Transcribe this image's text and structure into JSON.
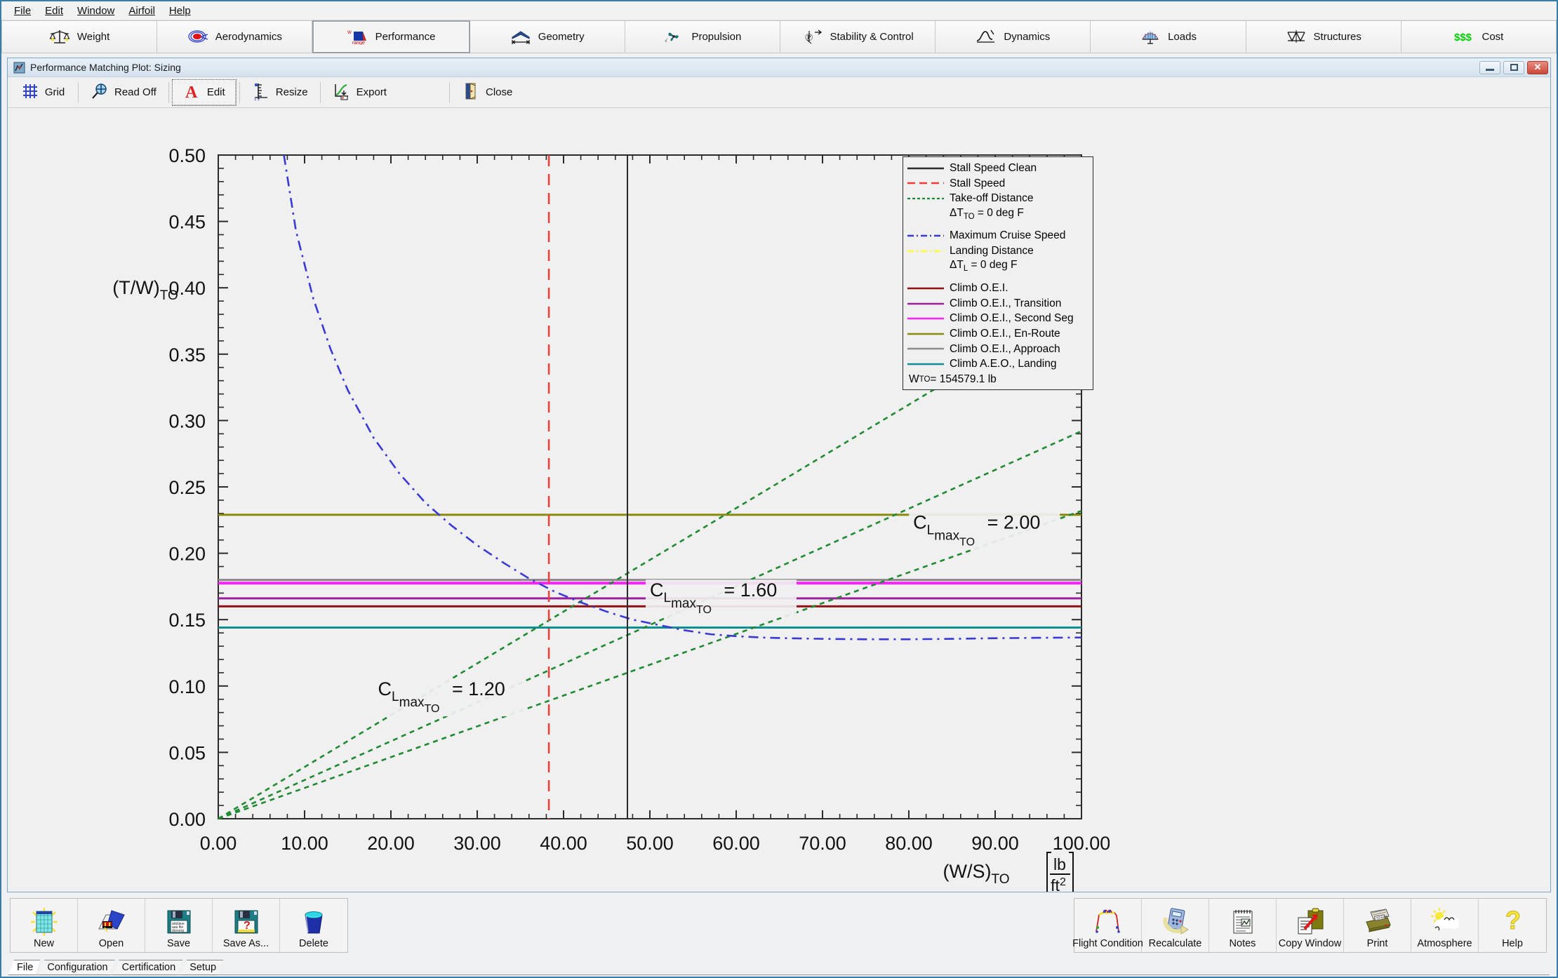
{
  "menu": {
    "items": [
      "File",
      "Edit",
      "Window",
      "Airfoil",
      "Help"
    ]
  },
  "modules": [
    {
      "label": "Weight",
      "icon": "balance-scale-icon",
      "active": false
    },
    {
      "label": "Aerodynamics",
      "icon": "airfoil-flow-icon",
      "active": false
    },
    {
      "label": "Performance",
      "icon": "range-chart-icon",
      "active": true
    },
    {
      "label": "Geometry",
      "icon": "wing-span-icon",
      "active": false
    },
    {
      "label": "Propulsion",
      "icon": "propeller-icon",
      "active": false
    },
    {
      "label": "Stability & Control",
      "icon": "axes-arrows-icon",
      "active": false
    },
    {
      "label": "Dynamics",
      "icon": "response-curve-icon",
      "active": false
    },
    {
      "label": "Loads",
      "icon": "load-distribution-icon",
      "active": false
    },
    {
      "label": "Structures",
      "icon": "truss-icon",
      "active": false
    },
    {
      "label": "Cost",
      "icon": "dollar-icon",
      "active": false
    }
  ],
  "window": {
    "title": "Performance Matching Plot: Sizing",
    "icon": "app-window-icon",
    "minimize_label": "",
    "maximize_label": "",
    "close_label": "✕"
  },
  "plot_toolbar": [
    {
      "label": "Grid",
      "icon": "grid-icon",
      "pressed": false
    },
    {
      "label": "Read Off",
      "icon": "crosshair-magnifier-icon",
      "pressed": false
    },
    {
      "label": "Edit",
      "icon": "letter-a-icon",
      "pressed": true
    },
    {
      "label": "Resize",
      "icon": "ruler-icon",
      "pressed": false
    },
    {
      "label": "Export",
      "icon": "export-curve-icon",
      "pressed": false
    },
    {
      "label": "Close",
      "icon": "exit-door-icon",
      "pressed": false
    }
  ],
  "legend": {
    "rows": [
      {
        "label": "Stall Speed Clean",
        "color": "#2b2b2b",
        "style": "solid"
      },
      {
        "label": "Stall Speed",
        "color": "#f43b35",
        "style": "dashed"
      },
      {
        "label": "Take-off Distance",
        "color": "#1f8a32",
        "style": "dotted"
      },
      {
        "label": "ΔT<TO> = 0 deg F",
        "color": "",
        "style": "continuation"
      },
      {
        "label": "",
        "color": "",
        "style": "spacer"
      },
      {
        "label": "Maximum Cruise Speed",
        "color": "#3b39d4",
        "style": "dashdot"
      },
      {
        "label": "Landing Distance",
        "color": "#ffff33",
        "style": "dashdot"
      },
      {
        "label": "ΔT<L> = 0 deg F",
        "color": "",
        "style": "continuation"
      },
      {
        "label": "",
        "color": "",
        "style": "spacer"
      },
      {
        "label": "Climb O.E.I.",
        "color": "#8e1010",
        "style": "solid"
      },
      {
        "label": "Climb O.E.I., Transition",
        "color": "#9c1f9c",
        "style": "solid"
      },
      {
        "label": "Climb O.E.I., Second Seg",
        "color": "#ff1fff",
        "style": "solid"
      },
      {
        "label": "Climb O.E.I., En-Route",
        "color": "#8a8a10",
        "style": "solid"
      },
      {
        "label": "Climb O.E.I., Approach",
        "color": "#8c8c8c",
        "style": "solid"
      },
      {
        "label": "Climb A.E.O., Landing",
        "color": "#0e8f91",
        "style": "solid"
      }
    ],
    "footer_prefix": "W",
    "footer_sub": "TO",
    "footer_value": " = 154579.1 lb"
  },
  "chart_data": {
    "type": "line",
    "title": "Performance Matching Plot: Sizing",
    "xlabel": "(W/S)TO",
    "xlabel_main": "(W/S)",
    "xlabel_sub": "TO",
    "xunits_num": "lb",
    "xunits_den": "ft",
    "xunits_den_exp": "2",
    "ylabel_main": "(T/W)",
    "ylabel_sub": "TO",
    "xlim": [
      0,
      100
    ],
    "ylim": [
      0,
      0.5
    ],
    "xticks": [
      "0.00",
      "10.00",
      "20.00",
      "30.00",
      "40.00",
      "50.00",
      "60.00",
      "70.00",
      "80.00",
      "90.00",
      "100.00"
    ],
    "xtick_values": [
      0,
      10,
      20,
      30,
      40,
      50,
      60,
      70,
      80,
      90,
      100
    ],
    "yticks": [
      "0.00",
      "0.05",
      "0.10",
      "0.15",
      "0.20",
      "0.25",
      "0.30",
      "0.35",
      "0.40",
      "0.45",
      "0.50"
    ],
    "ytick_values": [
      0,
      0.05,
      0.1,
      0.15,
      0.2,
      0.25,
      0.3,
      0.35,
      0.4,
      0.45,
      0.5
    ],
    "x_minor_per_major": 5,
    "y_minor_per_major": 5,
    "grid": false,
    "legend_position": "right-outside",
    "vertical_lines": [
      {
        "name": "Stall Speed Clean",
        "x": 47.4,
        "color": "#2b2b2b",
        "style": "solid",
        "width": 2
      },
      {
        "name": "Stall Speed",
        "x": 38.3,
        "color": "#f43b35",
        "style": "dashed",
        "width": 2.5
      }
    ],
    "horizontal_lines": [
      {
        "name": "Climb O.E.I., En-Route",
        "y": 0.229,
        "color": "#8a8a10",
        "width": 3
      },
      {
        "name": "Climb O.E.I., Approach",
        "y": 0.18,
        "color": "#8c8c8c",
        "width": 3
      },
      {
        "name": "Climb O.E.I., Second Seg",
        "y": 0.1775,
        "color": "#ff1fff",
        "width": 4
      },
      {
        "name": "Climb O.E.I., Transition",
        "y": 0.166,
        "color": "#9c1f9c",
        "width": 3
      },
      {
        "name": "Climb O.E.I.",
        "y": 0.16,
        "color": "#8e1010",
        "width": 3
      },
      {
        "name": "Climb A.E.O., Landing",
        "y": 0.144,
        "color": "#0e8f91",
        "width": 3
      }
    ],
    "series": [
      {
        "name": "Take-off Distance CLmaxTO = 2.00",
        "color": "#1f8a32",
        "style": "dotted",
        "points": [
          [
            0,
            0
          ],
          [
            10,
            0.039
          ],
          [
            20,
            0.078
          ],
          [
            30,
            0.117
          ],
          [
            40,
            0.156
          ],
          [
            50,
            0.195
          ],
          [
            60,
            0.234
          ],
          [
            70,
            0.273
          ],
          [
            80,
            0.312
          ],
          [
            90,
            0.351
          ],
          [
            100,
            0.39
          ]
        ]
      },
      {
        "name": "Take-off Distance CLmaxTO = 1.60",
        "color": "#1f8a32",
        "style": "dotted",
        "points": [
          [
            0,
            0
          ],
          [
            10,
            0.0292
          ],
          [
            20,
            0.0584
          ],
          [
            30,
            0.0876
          ],
          [
            40,
            0.1168
          ],
          [
            50,
            0.146
          ],
          [
            60,
            0.1752
          ],
          [
            70,
            0.2044
          ],
          [
            80,
            0.2336
          ],
          [
            90,
            0.2628
          ],
          [
            100,
            0.292
          ]
        ]
      },
      {
        "name": "Take-off Distance CLmaxTO = 1.20",
        "color": "#1f8a32",
        "style": "dotted",
        "points": [
          [
            0,
            0
          ],
          [
            10,
            0.0232
          ],
          [
            20,
            0.0464
          ],
          [
            30,
            0.0696
          ],
          [
            40,
            0.0928
          ],
          [
            50,
            0.116
          ],
          [
            60,
            0.1392
          ],
          [
            70,
            0.1624
          ],
          [
            80,
            0.1856
          ],
          [
            90,
            0.2088
          ],
          [
            100,
            0.232
          ]
        ]
      },
      {
        "name": "Maximum Cruise Speed",
        "color": "#3b39d4",
        "style": "dashdot",
        "points": [
          [
            7.6,
            0.5
          ],
          [
            9,
            0.443
          ],
          [
            11,
            0.392
          ],
          [
            13,
            0.354
          ],
          [
            15,
            0.323
          ],
          [
            18,
            0.287
          ],
          [
            21,
            0.26
          ],
          [
            24,
            0.238
          ],
          [
            27,
            0.221
          ],
          [
            30,
            0.206
          ],
          [
            33,
            0.193
          ],
          [
            36,
            0.181
          ],
          [
            39,
            0.171
          ],
          [
            42,
            0.163
          ],
          [
            45,
            0.156
          ],
          [
            48,
            0.15
          ],
          [
            51,
            0.146
          ],
          [
            54,
            0.142
          ],
          [
            57,
            0.139
          ],
          [
            60,
            0.1375
          ],
          [
            63,
            0.1365
          ],
          [
            66,
            0.136
          ],
          [
            70,
            0.1355
          ],
          [
            75,
            0.1352
          ],
          [
            80,
            0.1352
          ],
          [
            85,
            0.1355
          ],
          [
            90,
            0.136
          ],
          [
            95,
            0.1363
          ],
          [
            100,
            0.1365
          ]
        ]
      }
    ],
    "annotations": [
      {
        "text_prefix": "C",
        "sub1": "L",
        "sub2": "max",
        "sub3": "TO",
        "value": " = 2.00",
        "x": 80.5,
        "y": 0.2185
      },
      {
        "text_prefix": "C",
        "sub1": "L",
        "sub2": "max",
        "sub3": "TO",
        "value": " = 1.60",
        "x": 50.0,
        "y": 0.1675
      },
      {
        "text_prefix": "C",
        "sub1": "L",
        "sub2": "max",
        "sub3": "TO",
        "value": " = 1.20",
        "x": 18.5,
        "y": 0.093
      }
    ]
  },
  "bottom_left_buttons": [
    {
      "label": "New",
      "icon": "new-spreadsheet-icon"
    },
    {
      "label": "Open",
      "icon": "open-folder-icon"
    },
    {
      "label": "Save",
      "icon": "floppy-disk-icon"
    },
    {
      "label": "Save As...",
      "icon": "floppy-disk-question-icon"
    },
    {
      "label": "Delete",
      "icon": "trash-bin-icon"
    }
  ],
  "bottom_right_buttons": [
    {
      "label": "Flight Condition",
      "icon": "flight-profile-icon"
    },
    {
      "label": "Recalculate",
      "icon": "calculator-refresh-icon"
    },
    {
      "label": "Notes",
      "icon": "notepad-icon"
    },
    {
      "label": "Copy Window",
      "icon": "clipboard-copy-icon"
    },
    {
      "label": "Print",
      "icon": "printer-icon"
    },
    {
      "label": "Atmosphere",
      "icon": "sun-cloud-icon"
    },
    {
      "label": "Help",
      "icon": "question-mark-icon"
    }
  ],
  "tab_strip": {
    "tabs": [
      "File",
      "Configuration",
      "Certification",
      "Setup"
    ],
    "selected": "File"
  }
}
